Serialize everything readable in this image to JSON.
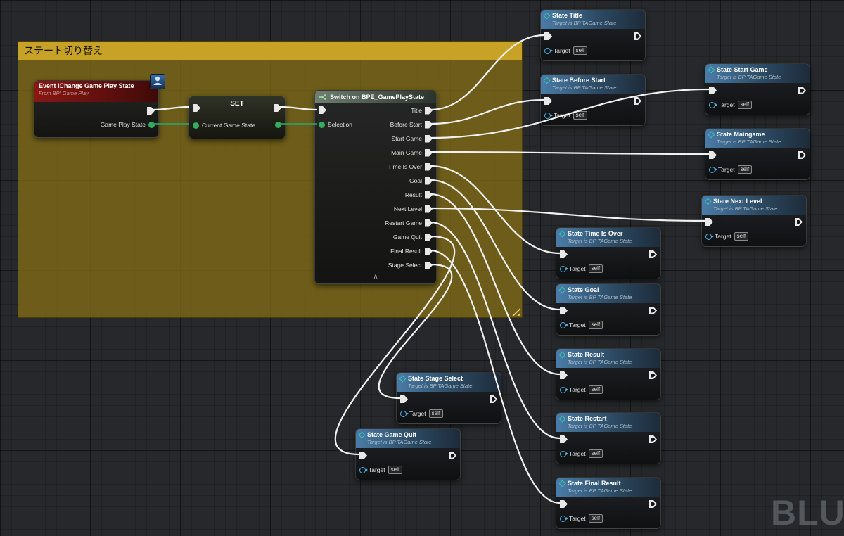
{
  "comment": {
    "title": "ステート切り替え"
  },
  "watermark": "BLUEPRINT",
  "event_node": {
    "title": "Event IChange Game Play State",
    "subtitle": "From BPI Game Play",
    "output_pin": "Game Play State"
  },
  "set_node": {
    "title": "SET",
    "input_pin": "Current Game State"
  },
  "switch_node": {
    "title": "Switch on BPE_GamePlayState",
    "selection_label": "Selection",
    "cases": [
      "Title",
      "Before Start",
      "Start Game",
      "Main Game",
      "Time Is Over",
      "Goal",
      "Result",
      "Next Level",
      "Restart Game",
      "Game Quit",
      "Final Result",
      "Stage Select"
    ]
  },
  "calls": [
    {
      "title": "State Title",
      "subtitle": "Target is BP TAGame State",
      "target_label": "Target",
      "self_label": "self"
    },
    {
      "title": "State Before Start",
      "subtitle": "Target is BP TAGame State",
      "target_label": "Target",
      "self_label": "self"
    },
    {
      "title": "State Start Game",
      "subtitle": "Target is BP TAGame State",
      "target_label": "Target",
      "self_label": "self"
    },
    {
      "title": "State Maingame",
      "subtitle": "Target is BP TAGame State",
      "target_label": "Target",
      "self_label": "self"
    },
    {
      "title": "State Next Level",
      "subtitle": "Target is BP TAGame State",
      "target_label": "Target",
      "self_label": "self"
    },
    {
      "title": "State Time Is Over",
      "subtitle": "Target is BP TAGame State",
      "target_label": "Target",
      "self_label": "self"
    },
    {
      "title": "State Goal",
      "subtitle": "Target is BP TAGame State",
      "target_label": "Target",
      "self_label": "self"
    },
    {
      "title": "State Result",
      "subtitle": "Target is BP TAGame State",
      "target_label": "Target",
      "self_label": "self"
    },
    {
      "title": "State Restart",
      "subtitle": "Target is BP TAGame State",
      "target_label": "Target",
      "self_label": "self"
    },
    {
      "title": "State Final Result",
      "subtitle": "Target is BP TAGame State",
      "target_label": "Target",
      "self_label": "self"
    },
    {
      "title": "State Stage Select",
      "subtitle": "Target is BP TAGame State",
      "target_label": "Target",
      "self_label": "self"
    },
    {
      "title": "State Game Quit",
      "subtitle": "Target is BP TAGame State",
      "target_label": "Target",
      "self_label": "self"
    }
  ]
}
